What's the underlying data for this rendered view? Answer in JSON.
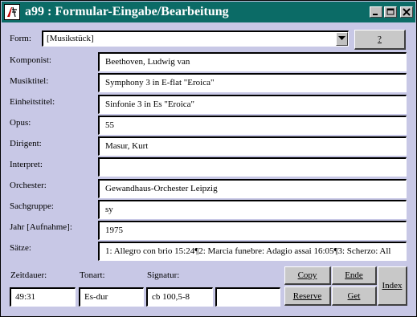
{
  "window": {
    "title": "a99 : Formular-Eingabe/Bearbeitung"
  },
  "form": {
    "label": "Form:",
    "selected": "[Musikstück]",
    "help_label": "?"
  },
  "fields": [
    {
      "label": "Komponist:",
      "value": "Beethoven, Ludwig van"
    },
    {
      "label": "Musiktitel:",
      "value": "Symphony 3 in E-flat \"Eroica\""
    },
    {
      "label": "Einheitstitel:",
      "value": "Sinfonie 3 in Es \"Eroica\""
    },
    {
      "label": "Opus:",
      "value": "55"
    },
    {
      "label": "Dirigent:",
      "value": "Masur, Kurt"
    },
    {
      "label": "Interpret:",
      "value": ""
    },
    {
      "label": "Orchester:",
      "value": "Gewandhaus-Orchester Leipzig"
    },
    {
      "label": "Sachgruppe:",
      "value": "sy"
    },
    {
      "label": "Jahr [Aufnahme]:",
      "value": "1975"
    },
    {
      "label": "Sätze:",
      "value": "1: Allegro con brio 15:24¶2: Marcia funebre: Adagio assai 16:05¶3: Scherzo: All"
    }
  ],
  "bottom": {
    "zeitdauer_label": "Zeitdauer:",
    "zeitdauer_value": "49:31",
    "tonart_label": "Tonart:",
    "tonart_value": "Es-dur",
    "signatur_label": "Signatur:",
    "signatur_value": "cb 100,5-8",
    "extra_value": ""
  },
  "buttons": {
    "copy": "Copy",
    "ende": "Ende",
    "index": "Index",
    "reserve": "Reserve",
    "get": "Get"
  },
  "colors": {
    "titlebar": "#0b6b66",
    "background": "#c8c8e6"
  }
}
